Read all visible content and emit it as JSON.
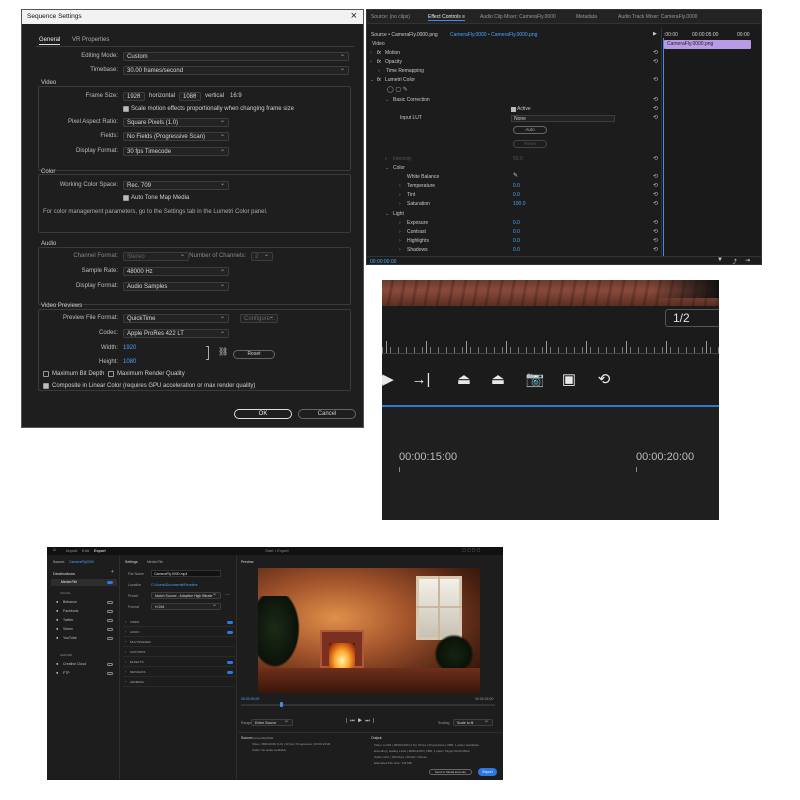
{
  "sequence_settings": {
    "title": "Sequence Settings",
    "close": "×",
    "tabs": [
      "General",
      "VR Properties"
    ],
    "editing_mode_label": "Editing Mode:",
    "editing_mode": "Custom",
    "timebase_label": "Timebase:",
    "timebase": "30.00 frames/second",
    "video_section": "Video",
    "frame_size_label": "Frame Size:",
    "frame_w": "1920",
    "horizontal": "horizontal",
    "frame_h": "1080",
    "vertical": "vertical",
    "ratio": "16:9",
    "scale_motion": "Scale motion effects proportionally when changing frame size",
    "par_label": "Pixel Aspect Ratio:",
    "par": "Square Pixels (1.0)",
    "fields_label": "Fields:",
    "fields": "No Fields (Progressive Scan)",
    "display_format_label": "Display Format:",
    "display_format": "30 fps Timecode",
    "color_section": "Color",
    "wcs_label": "Working Color Space:",
    "wcs": "Rec. 709",
    "auto_tone": "Auto Tone Map Media",
    "color_note": "For color management parameters, go to the Settings tab in the Lumetri Color panel.",
    "audio_section": "Audio",
    "channel_format_label": "Channel Format:",
    "channel_format": "Stereo",
    "num_channels_label": "Number of Channels:",
    "num_channels": "2",
    "sample_rate_label": "Sample Rate:",
    "sample_rate": "48000 Hz",
    "audio_display_label": "Display Format:",
    "audio_display": "Audio Samples",
    "previews_section": "Video Previews",
    "preview_format_label": "Preview File Format:",
    "preview_format": "QuickTime",
    "configure": "Configure...",
    "codec_label": "Codec:",
    "codec": "Apple ProRes 422 LT",
    "width_label": "Width:",
    "width": "1920",
    "height_label": "Height:",
    "height": "1080",
    "reset": "Reset",
    "max_bit_depth": "Maximum Bit Depth",
    "max_render_quality": "Maximum Render Quality",
    "composite_linear": "Composite in Linear Color (requires GPU acceleration or max render quality)",
    "ok": "OK",
    "cancel": "Cancel"
  },
  "effect_controls": {
    "tabs": [
      "Source: (no clips)",
      "Effect Controls ≡",
      "Audio Clip Mixer: CameraFly.0000",
      "Metadata",
      "Audio Track Mixer: CameraFly.0000"
    ],
    "source_path": "Source • CameraFly.0000.png",
    "clip_path": "CameraFly.0000 • CameraFly.0000.png",
    "timecodes": [
      ":00:00",
      "00:00:05:00",
      "00:00"
    ],
    "clip_label": "CameraFly.0000.png",
    "video": "Video",
    "rows": [
      "Motion",
      "Opacity",
      "Time Remapping",
      "Lumetri Color"
    ],
    "basic_correction": "Basic Correction",
    "active": "Active",
    "input_lut": "Input LUT",
    "lut_value": "None",
    "auto": "Auto",
    "reset": "Reset",
    "intensity": "Intensity",
    "intensity_val": "50.0",
    "color": "Color",
    "white_balance": "White Balance",
    "params": [
      {
        "name": "Temperature",
        "value": "0.0"
      },
      {
        "name": "Tint",
        "value": "0.0"
      },
      {
        "name": "Saturation",
        "value": "100.0"
      }
    ],
    "light": "Light",
    "light_params": [
      {
        "name": "Exposure",
        "value": "0.0"
      },
      {
        "name": "Contrast",
        "value": "0.0"
      },
      {
        "name": "Highlights",
        "value": "0.0"
      },
      {
        "name": "Shadows",
        "value": "0.0"
      }
    ],
    "footer_time": "00:00:00:00"
  },
  "program_monitor": {
    "resolution": "1/2",
    "timecode_a": "00:00:15:00",
    "timecode_b": "00:00:20:00"
  },
  "export": {
    "nav": [
      "Import",
      "Edit",
      "Export"
    ],
    "header_center": "Start • Export",
    "source_label": "Source:",
    "source_name": "CameraFly0000",
    "destinations": "Destinations",
    "media_file": "Media File",
    "social": "SOCIAL",
    "social_items": [
      "Behance",
      "Facebook",
      "Twitter",
      "Vimeo",
      "YouTube"
    ],
    "server": "SERVER",
    "server_items": [
      "Creative Cloud",
      "FTP"
    ],
    "settings_title": "Settings",
    "settings_tab": "Media File",
    "file_name_label": "File Name",
    "file_name": "CameraFly.0000.mp4",
    "location_label": "Location",
    "location": "C:\\Users\\Documents\\Renders",
    "preset_label": "Preset",
    "preset": "Match Source - Adaptive High Bitrate",
    "format_label": "Format",
    "format": "H.264",
    "sections": [
      "VIDEO",
      "AUDIO",
      "MULTIPLEXER",
      "CAPTIONS",
      "EFFECTS",
      "METADATA",
      "GENERAL"
    ],
    "preview": "Preview",
    "time_start": "00:00:00;00",
    "time_end": "00:00:24;00",
    "range_label": "Range",
    "range": "Entire Source",
    "scaling_label": "Scaling",
    "scaling": "Scale to fit",
    "summary_source": "Source",
    "summary_output": "Output",
    "summary_source_lines": [
      "CameraFly0000",
      "Video: 3840x2160 (1.0) | 30 fps | Progressive | 00:00:24:00",
      "Audio: No audio available"
    ],
    "summary_output_lines": [
      "Video: H.264 | 3840x2160 (1.0) | 30 fps | Progressive | VBR, 1 pass | Hardware",
      "Encoding | Hadley Links | 3840x2160 | VBR, 1 pass | Target 50.00 Mbps",
      "Audio: AAC | 320 kbps | 48 kHz | Stereo",
      "Estimated File Size: 143 MB"
    ],
    "send_to_encoder": "Send to Media Encoder",
    "export_button": "Export"
  }
}
